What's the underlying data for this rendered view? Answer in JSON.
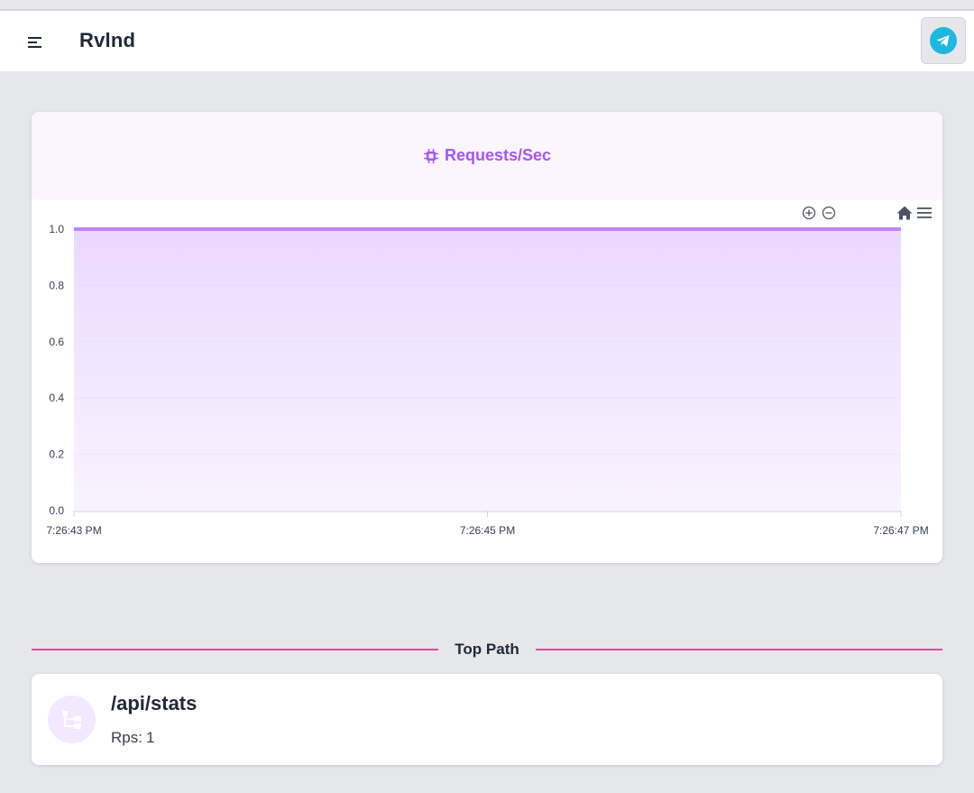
{
  "app": {
    "title": "Rvlnd"
  },
  "navbar": {
    "menu_icon": "menu-icon",
    "action_icon": "telegram-icon"
  },
  "chart_card": {
    "title": "Requests/Sec",
    "title_icon": "cpu-chip-icon",
    "toolbar": [
      "zoom-in-icon",
      "zoom-out-icon",
      "home-reset-icon",
      "hamburger-menu-icon"
    ]
  },
  "chart_data": {
    "type": "area",
    "title": "Requests/Sec",
    "x": [
      "7:26:43 PM",
      "7:26:45 PM",
      "7:26:47 PM"
    ],
    "series": [
      {
        "values": [
          1,
          1,
          1
        ]
      }
    ],
    "xticks": [
      "7:26:43 PM",
      "7:26:45 PM",
      "7:26:47 PM"
    ],
    "yticks": [
      "0.0",
      "0.2",
      "0.4",
      "0.6",
      "0.8",
      "1.0"
    ],
    "ylim": [
      0,
      1
    ],
    "grid": true,
    "colors": {
      "line": "#c084fc",
      "fill": "#e9d5ff"
    }
  },
  "top_path": {
    "heading": "Top Path",
    "items": [
      {
        "path": "/api/stats",
        "rps_label": "Rps:",
        "rps_value": "1",
        "icon": "tree-structure-icon"
      }
    ]
  },
  "colors": {
    "accent": "#a855f7",
    "divider": "#ec4899",
    "background": "#e5e7eb",
    "telegram": "#1fb6e0"
  }
}
